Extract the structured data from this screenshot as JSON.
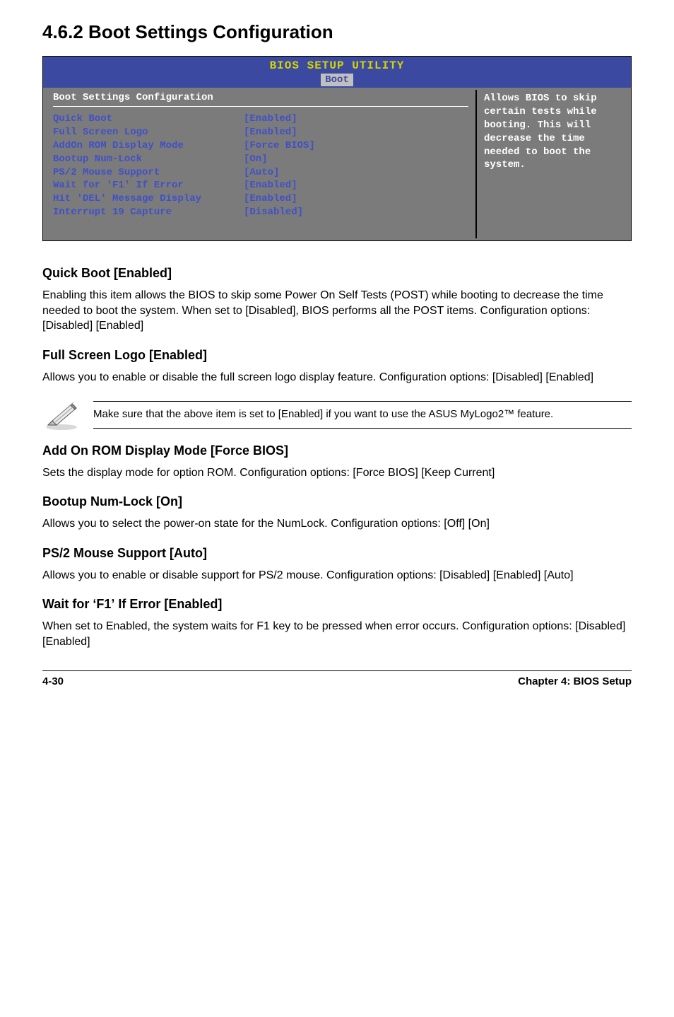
{
  "heading": "4.6.2  Boot Settings Configuration",
  "bios": {
    "utility_title": "BIOS SETUP UTILITY",
    "tab": "Boot",
    "left_title": "Boot Settings Configuration",
    "rows": [
      {
        "label": "Quick Boot",
        "value": "[Enabled]"
      },
      {
        "label": "Full Screen Logo",
        "value": "[Enabled]"
      },
      {
        "label": "AddOn ROM Display Mode",
        "value": "[Force BIOS]"
      },
      {
        "label": "Bootup Num-Lock",
        "value": "[On]"
      },
      {
        "label": "PS/2 Mouse Support",
        "value": "[Auto]"
      },
      {
        "label": "Wait for 'F1' If Error",
        "value": "[Enabled]"
      },
      {
        "label": "Hit 'DEL' Message Display",
        "value": "[Enabled]"
      },
      {
        "label": "Interrupt 19 Capture",
        "value": "[Disabled]"
      }
    ],
    "help_text": "Allows BIOS to skip certain tests while booting. This will decrease the time needed to boot the system."
  },
  "sections": {
    "quick_boot": {
      "title": "Quick Boot [Enabled]",
      "body": "Enabling this item allows the BIOS to skip some Power On Self Tests (POST) while booting to decrease the time needed to boot the system. When set to [Disabled], BIOS performs all the POST items. Configuration options: [Disabled] [Enabled]"
    },
    "full_screen_logo": {
      "title": "Full Screen Logo [Enabled]",
      "body": "Allows you to enable or disable the full screen logo display feature. Configuration options: [Disabled] [Enabled]"
    },
    "note": {
      "text": "Make sure that the above item is set to [Enabled] if you want to use the ASUS MyLogo2™ feature."
    },
    "add_on_rom": {
      "title": "Add On ROM Display Mode [Force BIOS]",
      "body": "Sets the display mode for option ROM. Configuration options: [Force BIOS] [Keep Current]"
    },
    "bootup_numlock": {
      "title": "Bootup Num-Lock [On]",
      "body": "Allows you to select the power-on state for the NumLock. Configuration options: [Off] [On]"
    },
    "ps2_mouse": {
      "title": "PS/2 Mouse Support [Auto]",
      "body": "Allows you to enable or disable support for PS/2 mouse. Configuration options: [Disabled] [Enabled] [Auto]"
    },
    "wait_f1": {
      "title": "Wait for ʻF1ʼ If Error [Enabled]",
      "body": "When set to Enabled, the system waits for F1 key to be pressed when error occurs. Configuration options: [Disabled] [Enabled]"
    }
  },
  "footer": {
    "page_num": "4-30",
    "chapter": "Chapter 4: BIOS Setup"
  }
}
